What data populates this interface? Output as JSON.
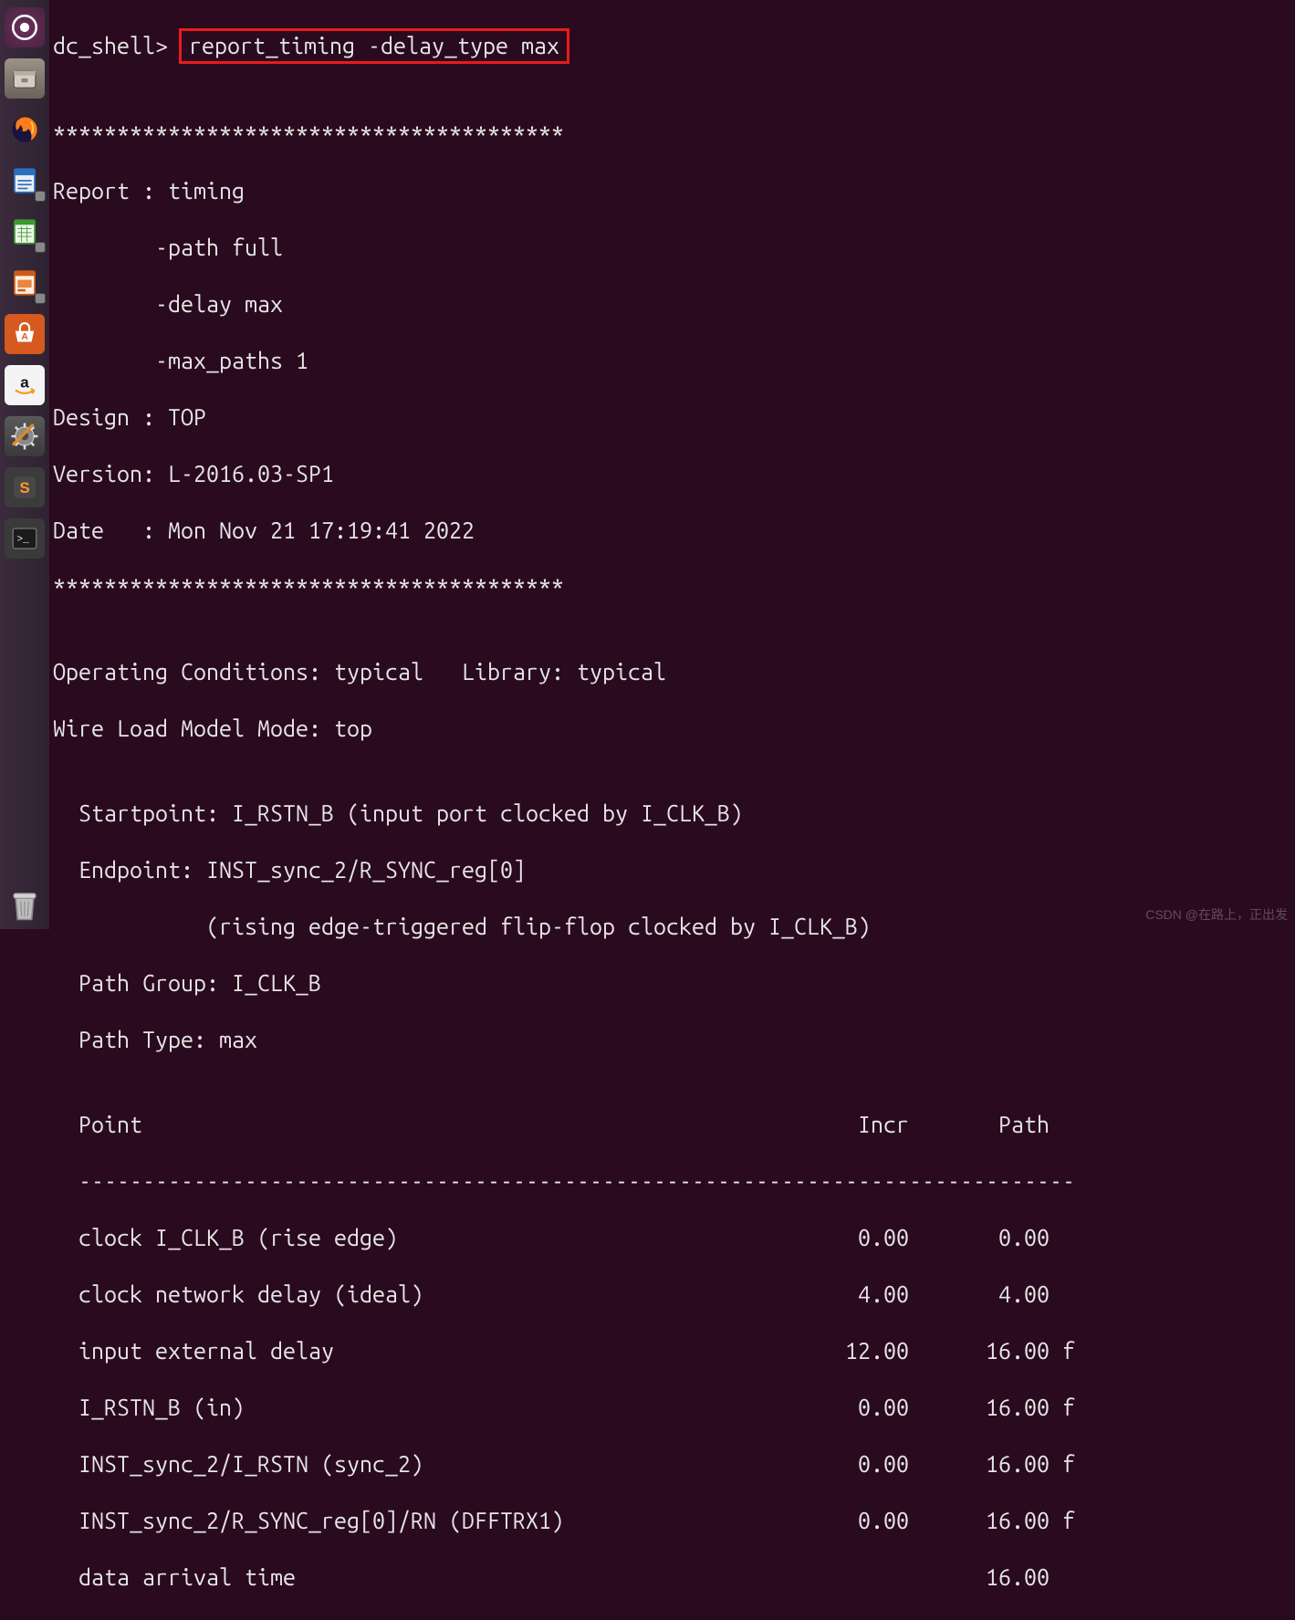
{
  "watermark": "CSDN @在路上，正出发",
  "term": {
    "l0": "dc_shell> ",
    "cmd": "report_timing -delay_type max",
    "blank": "",
    "stars": "****************************************",
    "l1": "Report : timing",
    "l2": "        -path full",
    "l3": "        -delay max",
    "l4": "        -max_paths 1",
    "l5": "Design : TOP",
    "l6": "Version: L-2016.03-SP1",
    "l7": "Date   : Mon Nov 21 17:19:41 2022",
    "l8": "Operating Conditions: typical   Library: typical",
    "l9": "Wire Load Model Mode: top",
    "l10": "  Startpoint: I_RSTN_B (input port clocked by I_CLK_B)",
    "l11": "  Endpoint: INST_sync_2/R_SYNC_reg[0]",
    "l12": "            (rising edge-triggered flip-flop clocked by I_CLK_B)",
    "l13": "  Path Group: I_CLK_B",
    "l14": "  Path Type: max",
    "l15": "  Point                                                        Incr       Path",
    "l16": "  ------------------------------------------------------------------------------",
    "r0": "  clock I_CLK_B (rise edge)                                    0.00       0.00",
    "r1": "  clock network delay (ideal)                                  4.00       4.00",
    "r2": "  input external delay                                        12.00      16.00 f",
    "r3": "  I_RSTN_B (in)                                                0.00      16.00 f",
    "r4": "  INST_sync_2/I_RSTN (sync_2)                                  0.00      16.00 f",
    "r5": "  INST_sync_2/R_SYNC_reg[0]/RN (DFFTRX1)                       0.00      16.00 f",
    "r6": "  data arrival time                                                      16.00"
  }
}
